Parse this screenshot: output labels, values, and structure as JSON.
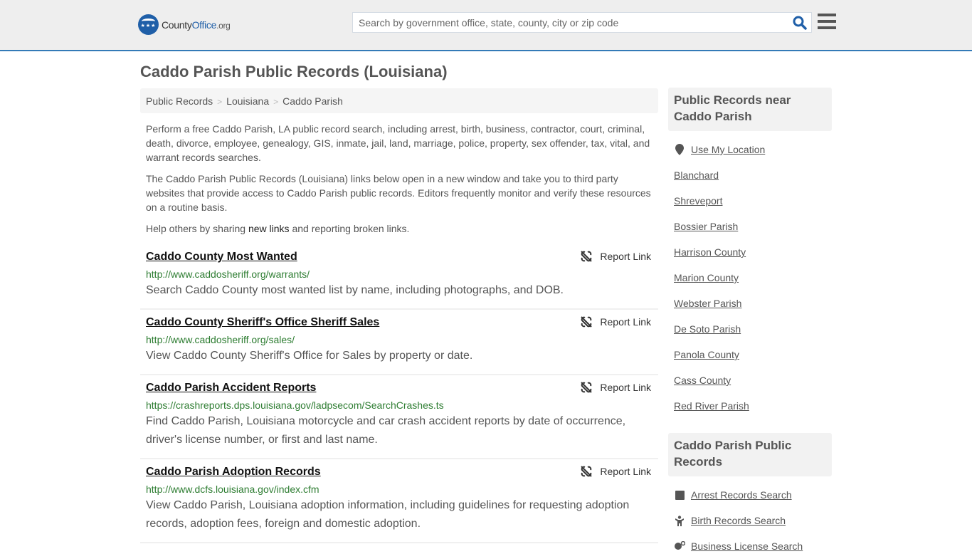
{
  "header": {
    "logo": {
      "county": "County",
      "office": "Office",
      "org": ".org",
      "stars": "★★★"
    },
    "search": {
      "placeholder": "Search by government office, state, county, city or zip code",
      "value": ""
    }
  },
  "page": {
    "title": "Caddo Parish Public Records (Louisiana)"
  },
  "breadcrumb": [
    {
      "label": "Public Records"
    },
    {
      "label": "Louisiana"
    },
    {
      "label": "Caddo Parish"
    }
  ],
  "breadcrumb_separator": ">",
  "intro": {
    "p1": "Perform a free Caddo Parish, LA public record search, including arrest, birth, business, contractor, court, criminal, death, divorce, employee, genealogy, GIS, inmate, jail, land, marriage, police, property, sex offender, tax, vital, and warrant records searches.",
    "p2": "The Caddo Parish Public Records (Louisiana) links below open in a new window and take you to third party websites that provide access to Caddo Parish public records. Editors frequently monitor and verify these resources on a routine basis.",
    "p3_before": "Help others by sharing ",
    "p3_link": "new links",
    "p3_after": " and reporting broken links."
  },
  "results": [
    {
      "title": "Caddo County Most Wanted",
      "url": "http://www.caddosheriff.org/warrants/",
      "description": "Search Caddo County most wanted list by name, including photographs, and DOB.",
      "report_label": "Report Link"
    },
    {
      "title": "Caddo County Sheriff's Office Sheriff Sales",
      "url": "http://www.caddosheriff.org/sales/",
      "description": "View Caddo County Sheriff's Office for Sales by property or date.",
      "report_label": "Report Link"
    },
    {
      "title": "Caddo Parish Accident Reports",
      "url": "https://crashreports.dps.louisiana.gov/ladpsecom/SearchCrashes.ts",
      "description": "Find Caddo Parish, Louisiana motorcycle and car crash accident reports by date of occurrence, driver's license number, or first and last name.",
      "report_label": "Report Link"
    },
    {
      "title": "Caddo Parish Adoption Records",
      "url": "http://www.dcfs.louisiana.gov/index.cfm",
      "description": "View Caddo Parish, Louisiana adoption information, including guidelines for requesting adoption records, adoption fees, foreign and domestic adoption.",
      "report_label": "Report Link"
    }
  ],
  "sidebar": {
    "nearby": {
      "title": "Public Records near Caddo Parish",
      "use_location": {
        "label": "Use My Location",
        "icon": "map-marker-icon"
      },
      "items": [
        "Blanchard",
        "Shreveport",
        "Bossier Parish",
        "Harrison County",
        "Marion County",
        "Webster Parish",
        "De Soto Parish",
        "Panola County",
        "Cass County",
        "Red River Parish"
      ]
    },
    "records": {
      "title": "Caddo Parish Public Records",
      "items": [
        {
          "label": "Arrest Records Search",
          "icon": "square-icon"
        },
        {
          "label": "Birth Records Search",
          "icon": "child-icon"
        },
        {
          "label": "Business License Search",
          "icon": "business-icon"
        }
      ]
    }
  },
  "colors": {
    "accent": "#337ab7",
    "brand": "#1f5fa8",
    "url_green": "#2e7d32"
  }
}
